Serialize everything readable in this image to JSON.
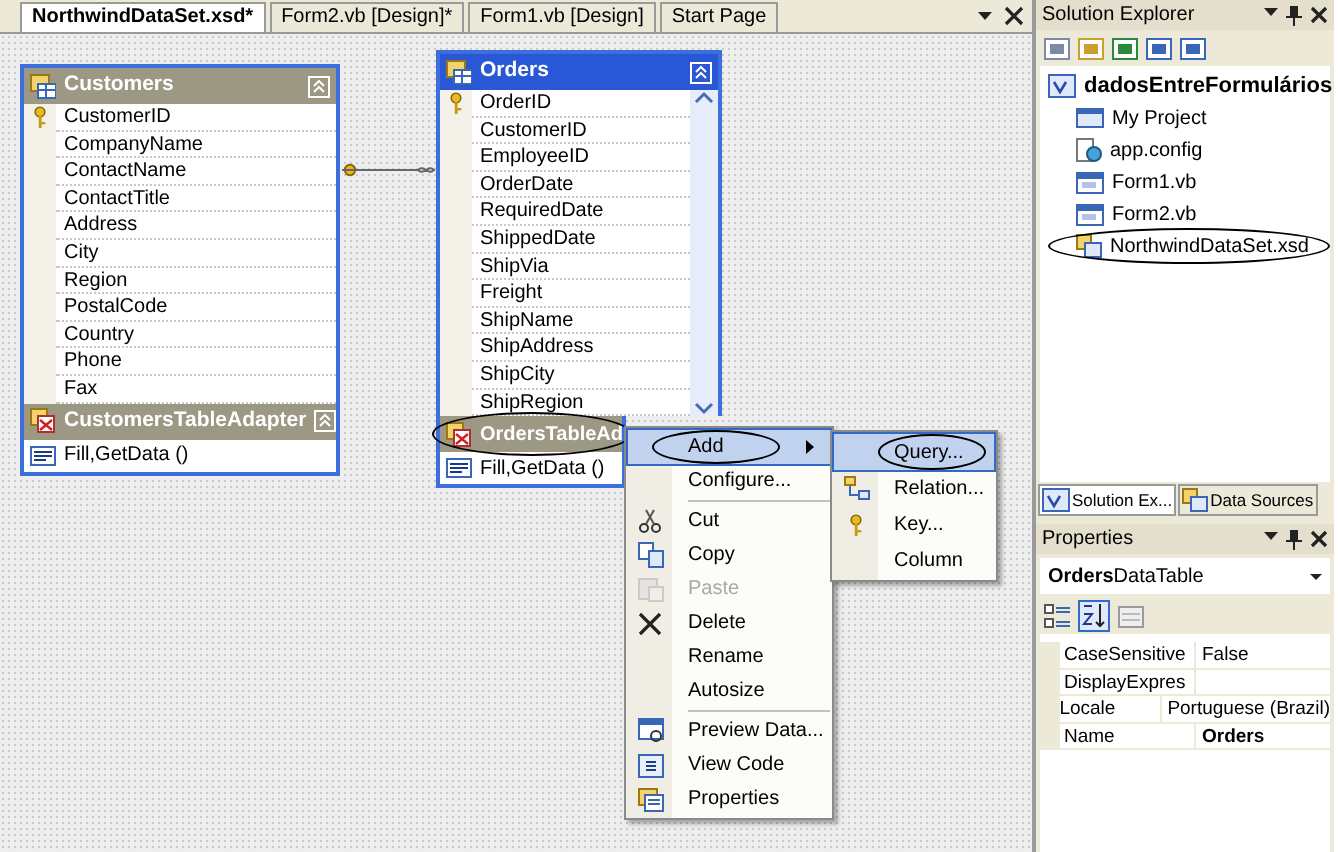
{
  "document_tabs": [
    {
      "label": "NorthwindDataSet.xsd*",
      "selected": true
    },
    {
      "label": "Form2.vb [Design]*",
      "selected": false
    },
    {
      "label": "Form1.vb [Design]",
      "selected": false
    },
    {
      "label": "Start Page",
      "selected": false
    }
  ],
  "tables": [
    {
      "name": "Customers",
      "selected": false,
      "columns": [
        {
          "name": "CustomerID",
          "key": true
        },
        {
          "name": "CompanyName",
          "key": false
        },
        {
          "name": "ContactName",
          "key": false
        },
        {
          "name": "ContactTitle",
          "key": false
        },
        {
          "name": "Address",
          "key": false
        },
        {
          "name": "City",
          "key": false
        },
        {
          "name": "Region",
          "key": false
        },
        {
          "name": "PostalCode",
          "key": false
        },
        {
          "name": "Country",
          "key": false
        },
        {
          "name": "Phone",
          "key": false
        },
        {
          "name": "Fax",
          "key": false
        }
      ],
      "adapter": {
        "name": "CustomersTableAdapter",
        "circled": false,
        "queries": [
          "Fill,GetData ()"
        ]
      }
    },
    {
      "name": "Orders",
      "selected": true,
      "columns": [
        {
          "name": "OrderID",
          "key": true
        },
        {
          "name": "CustomerID",
          "key": false
        },
        {
          "name": "EmployeeID",
          "key": false
        },
        {
          "name": "OrderDate",
          "key": false
        },
        {
          "name": "RequiredDate",
          "key": false
        },
        {
          "name": "ShippedDate",
          "key": false
        },
        {
          "name": "ShipVia",
          "key": false
        },
        {
          "name": "Freight",
          "key": false
        },
        {
          "name": "ShipName",
          "key": false
        },
        {
          "name": "ShipAddress",
          "key": false
        },
        {
          "name": "ShipCity",
          "key": false
        },
        {
          "name": "ShipRegion",
          "key": false
        }
      ],
      "adapter": {
        "name": "OrdersTableAd",
        "circled": true,
        "queries": [
          "Fill,GetData ()"
        ]
      }
    }
  ],
  "context_menu": {
    "items": [
      {
        "kind": "item",
        "label": "Add",
        "selected": true,
        "disabled": false,
        "submenu": true,
        "circled": true
      },
      {
        "kind": "item",
        "label": "Configure...",
        "selected": false,
        "disabled": false,
        "submenu": false,
        "circled": false
      },
      {
        "kind": "separator"
      },
      {
        "kind": "item",
        "label": "Cut",
        "selected": false,
        "disabled": false,
        "submenu": false,
        "circled": false
      },
      {
        "kind": "item",
        "label": "Copy",
        "selected": false,
        "disabled": false,
        "submenu": false,
        "circled": false
      },
      {
        "kind": "item",
        "label": "Paste",
        "selected": false,
        "disabled": true,
        "submenu": false,
        "circled": false
      },
      {
        "kind": "item",
        "label": "Delete",
        "selected": false,
        "disabled": false,
        "submenu": false,
        "circled": false
      },
      {
        "kind": "item",
        "label": "Rename",
        "selected": false,
        "disabled": false,
        "submenu": false,
        "circled": false
      },
      {
        "kind": "item",
        "label": "Autosize",
        "selected": false,
        "disabled": false,
        "submenu": false,
        "circled": false
      },
      {
        "kind": "separator"
      },
      {
        "kind": "item",
        "label": "Preview Data...",
        "selected": false,
        "disabled": false,
        "submenu": false,
        "circled": false
      },
      {
        "kind": "item",
        "label": "View Code",
        "selected": false,
        "disabled": false,
        "submenu": false,
        "circled": false
      },
      {
        "kind": "item",
        "label": "Properties",
        "selected": false,
        "disabled": false,
        "submenu": false,
        "circled": false
      }
    ]
  },
  "submenu": {
    "items": [
      {
        "label": "Query...",
        "selected": true,
        "circled": true
      },
      {
        "label": "Relation...",
        "selected": false,
        "circled": false
      },
      {
        "label": "Key...",
        "selected": false,
        "circled": false
      },
      {
        "label": "Column",
        "selected": false,
        "circled": false
      }
    ]
  },
  "solution_explorer": {
    "title": "Solution Explorer",
    "project": "dadosEntreFormulários",
    "items": [
      {
        "label": "My Project",
        "circled": false
      },
      {
        "label": "app.config",
        "circled": false
      },
      {
        "label": "Form1.vb",
        "circled": false
      },
      {
        "label": "Form2.vb",
        "circled": false
      },
      {
        "label": "NorthwindDataSet.xsd",
        "circled": true
      }
    ]
  },
  "panel_tabs": [
    {
      "label": "Solution Ex...",
      "selected": true
    },
    {
      "label": "Data Sources",
      "selected": false
    }
  ],
  "properties": {
    "title": "Properties",
    "object_name": "Orders",
    "object_type": "DataTable",
    "rows": [
      {
        "name": "CaseSensitive",
        "value": "False",
        "bold": false
      },
      {
        "name": "DisplayExpres",
        "value": ""
      },
      {
        "name": "Locale",
        "value": "Portuguese (Brazil)",
        "bold": false
      },
      {
        "name": "Name",
        "value": "Orders",
        "bold": true
      }
    ]
  }
}
